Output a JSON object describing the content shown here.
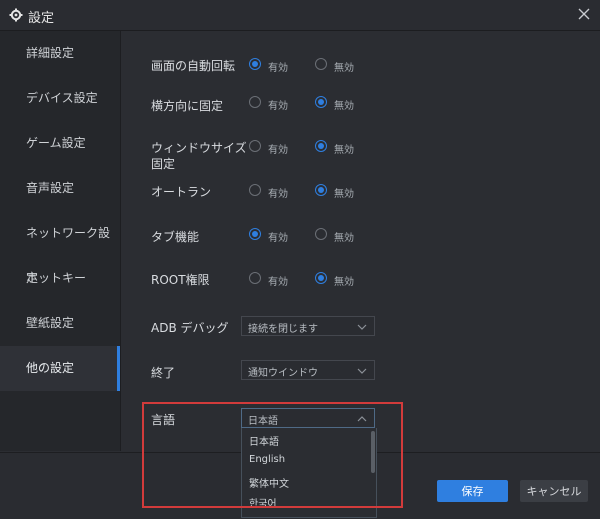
{
  "window": {
    "title": "設定"
  },
  "sidebar": {
    "items": [
      {
        "label": "詳細設定"
      },
      {
        "label": "デバイス設定"
      },
      {
        "label": "ゲーム設定"
      },
      {
        "label": "音声設定"
      },
      {
        "label": "ネットワーク設定"
      },
      {
        "label": "ホットキー"
      },
      {
        "label": "壁紙設定"
      },
      {
        "label": "他の設定",
        "active": true
      }
    ]
  },
  "settings": {
    "auto_rotate": {
      "label": "画面の自動回転",
      "on": "有効",
      "off": "無効",
      "selected": "有効"
    },
    "landscape_fix": {
      "label": "横方向に固定",
      "on": "有効",
      "off": "無効",
      "selected": "無効"
    },
    "window_size_fix": {
      "label_line1": "ウィンドウサイズ",
      "label_line2": "固定",
      "on": "有効",
      "off": "無効",
      "selected": "無効"
    },
    "autorun": {
      "label": "オートラン",
      "on": "有効",
      "off": "無効",
      "selected": "無効"
    },
    "tap_feature": {
      "label": "タブ機能",
      "on": "有効",
      "off": "無効",
      "selected": "有効"
    },
    "root": {
      "label": "ROOT権限",
      "on": "有効",
      "off": "無効",
      "selected": "無効"
    },
    "adb_debug": {
      "label": "ADB デバッグ",
      "value": "接続を閉じます"
    },
    "exit": {
      "label": "終了",
      "value": "通知ウインドウ"
    },
    "language": {
      "label": "言語",
      "value": "日本語",
      "options": [
        "日本語",
        "English",
        "繁体中文",
        "한국어"
      ]
    }
  },
  "footer": {
    "save": "保存",
    "cancel": "キャンセル"
  },
  "colors": {
    "accent": "#2f7fe0",
    "highlight": "#d23b3b",
    "background": "#2b2d32"
  }
}
